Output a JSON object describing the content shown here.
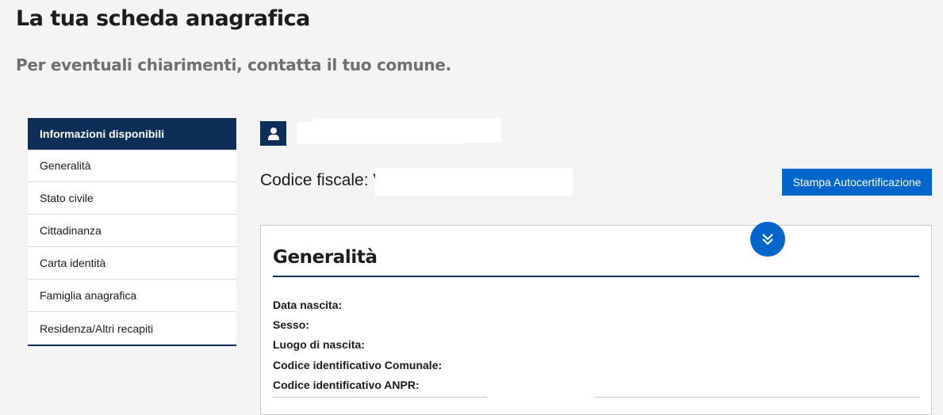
{
  "page": {
    "title": "La tua scheda anagrafica",
    "subtitle": "Per eventuali chiarimenti, contatta il tuo comune."
  },
  "sidebar": {
    "header": "Informazioni disponibili",
    "items": [
      {
        "label": "Generalità"
      },
      {
        "label": "Stato civile"
      },
      {
        "label": "Cittadinanza"
      },
      {
        "label": "Carta identità"
      },
      {
        "label": "Famiglia anagrafica"
      },
      {
        "label": "Residenza/Altri recapiti"
      }
    ]
  },
  "profile": {
    "icon": "user-icon",
    "codice_fiscale_label": "Codice fiscale: V",
    "print_button": "Stampa Autocertificazione"
  },
  "card": {
    "collapse_icon": "double-chevron-down-icon",
    "title": "Generalità",
    "fields": [
      {
        "label": "Data nascita:"
      },
      {
        "label": "Sesso:"
      },
      {
        "label": "Luogo di nascita:"
      },
      {
        "label": "Codice identificativo Comunale:"
      },
      {
        "label": "Codice identificativo ANPR:"
      }
    ]
  },
  "colors": {
    "navy": "#0d2e57",
    "primary_blue": "#0066cc",
    "background": "#f4f4f4"
  }
}
